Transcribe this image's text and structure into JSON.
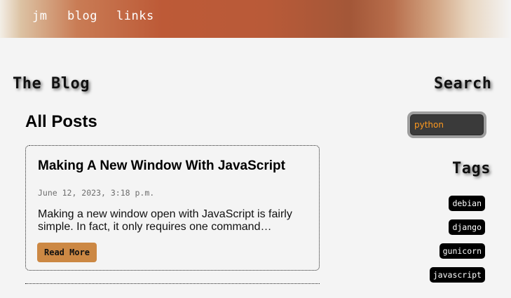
{
  "nav": {
    "items": [
      {
        "label": "jm"
      },
      {
        "label": "blog"
      },
      {
        "label": "links"
      }
    ]
  },
  "sidebar_left": {
    "heading": "The Blog"
  },
  "main": {
    "title": "All Posts",
    "posts": [
      {
        "title": "Making A New Window With JavaScript",
        "date": "June 12, 2023, 3:18 p.m.",
        "excerpt": "Making a new window open with JavaScript is fairly simple. In fact, it only requires one command…",
        "read_more_label": "Read More"
      }
    ]
  },
  "search": {
    "heading": "Search",
    "value": "python"
  },
  "tags": {
    "heading": "Tags",
    "items": [
      {
        "label": "debian"
      },
      {
        "label": "django"
      },
      {
        "label": "gunicorn"
      },
      {
        "label": "javascript"
      }
    ]
  },
  "colors": {
    "read_more_button": "#cc8844",
    "search_text": "#ff9a1f",
    "tag_background": "#000000"
  }
}
